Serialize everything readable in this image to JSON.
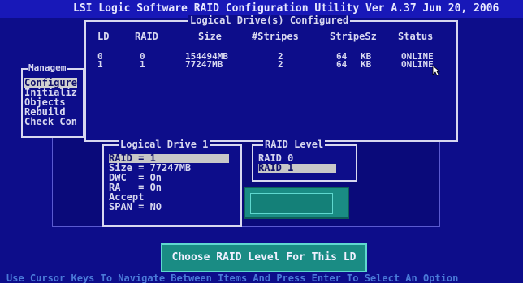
{
  "title_bar": "LSI Logic Software RAID Configuration Utility Ver A.37 Jun 20, 2006",
  "main_menu": {
    "caption": "Managem",
    "items": [
      {
        "label": "Configure",
        "selected": true
      },
      {
        "label": "Initializ",
        "selected": false
      },
      {
        "label": "Objects",
        "selected": false
      },
      {
        "label": "Rebuild",
        "selected": false
      },
      {
        "label": "Check Con",
        "selected": false
      }
    ]
  },
  "logical_drives": {
    "title": "Logical Drive(s) Configured",
    "columns": [
      "LD",
      "RAID",
      "Size",
      "#Stripes",
      "StripeSz",
      "Status"
    ],
    "rows": [
      {
        "ld": "0",
        "raid": "0",
        "size": "154494MB",
        "stripes": "2",
        "stripesz_num": "64",
        "stripesz_unit": "KB",
        "status": "ONLINE"
      },
      {
        "ld": "1",
        "raid": "1",
        "size": "77247MB",
        "stripes": "2",
        "stripesz_num": "64",
        "stripesz_unit": "KB",
        "status": "ONLINE"
      }
    ]
  },
  "logical_drive_1": {
    "title": "Logical Drive 1",
    "fields": [
      {
        "label": "RAID = 1",
        "selected": true
      },
      {
        "label": "Size = 77247MB",
        "selected": false
      },
      {
        "label": "DWC  = On",
        "selected": false
      },
      {
        "label": "RA   = On",
        "selected": false
      },
      {
        "label": "Accept",
        "selected": false
      },
      {
        "label": "SPAN = NO",
        "selected": false
      }
    ]
  },
  "raid_level": {
    "title": "RAID Level",
    "options": [
      {
        "label": "RAID 0",
        "selected": false
      },
      {
        "label": "RAID 1",
        "selected": true
      }
    ]
  },
  "help_prompt": "Choose RAID Level For This LD",
  "status_bar": "Use Cursor Keys To Navigate Between Items And Press Enter To Select An Option",
  "colors": {
    "background": "#0d0d8a",
    "title_bar": "#1818b8",
    "highlight": "#c8c8c8",
    "help_box": "#1a8c84"
  }
}
